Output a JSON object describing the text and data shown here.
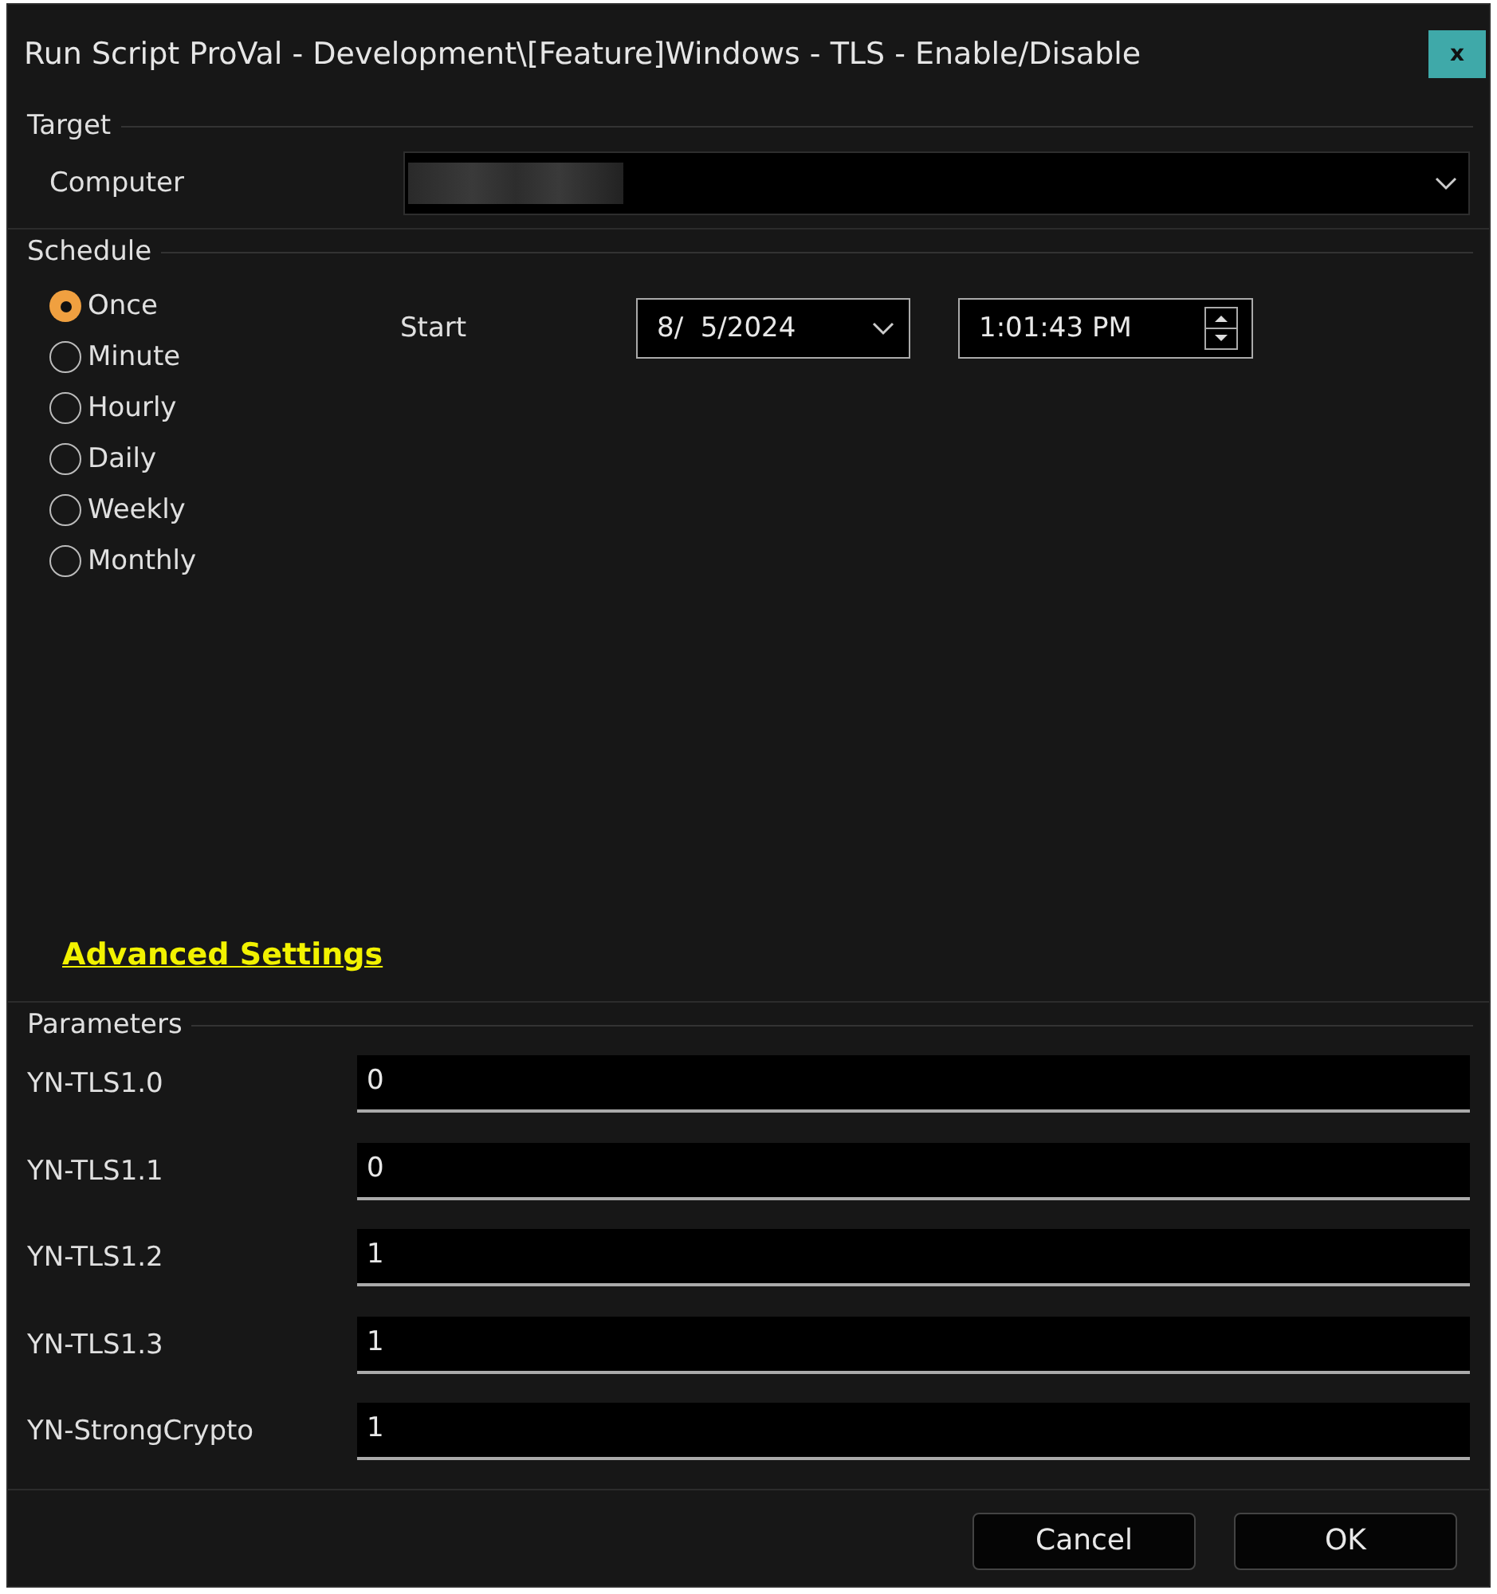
{
  "window": {
    "title": "Run Script ProVal - Development\\[Feature]Windows - TLS - Enable/Disable",
    "close": "x"
  },
  "target": {
    "heading": "Target",
    "computer_label": "Computer"
  },
  "schedule": {
    "heading": "Schedule",
    "options": [
      {
        "label": "Once",
        "selected": true
      },
      {
        "label": "Minute",
        "selected": false
      },
      {
        "label": "Hourly",
        "selected": false
      },
      {
        "label": "Daily",
        "selected": false
      },
      {
        "label": "Weekly",
        "selected": false
      },
      {
        "label": "Monthly",
        "selected": false
      }
    ],
    "start_label": "Start",
    "date": "8/  5/2024",
    "time": "1:01:43 PM"
  },
  "advanced_link": "Advanced Settings",
  "parameters": {
    "heading": "Parameters",
    "rows": [
      {
        "label": "YN-TLS1.0",
        "value": "0"
      },
      {
        "label": "YN-TLS1.1",
        "value": "0"
      },
      {
        "label": "YN-TLS1.2",
        "value": "1"
      },
      {
        "label": "YN-TLS1.3",
        "value": "1"
      },
      {
        "label": "YN-StrongCrypto",
        "value": "1"
      }
    ]
  },
  "buttons": [
    "Cancel",
    "OK"
  ]
}
